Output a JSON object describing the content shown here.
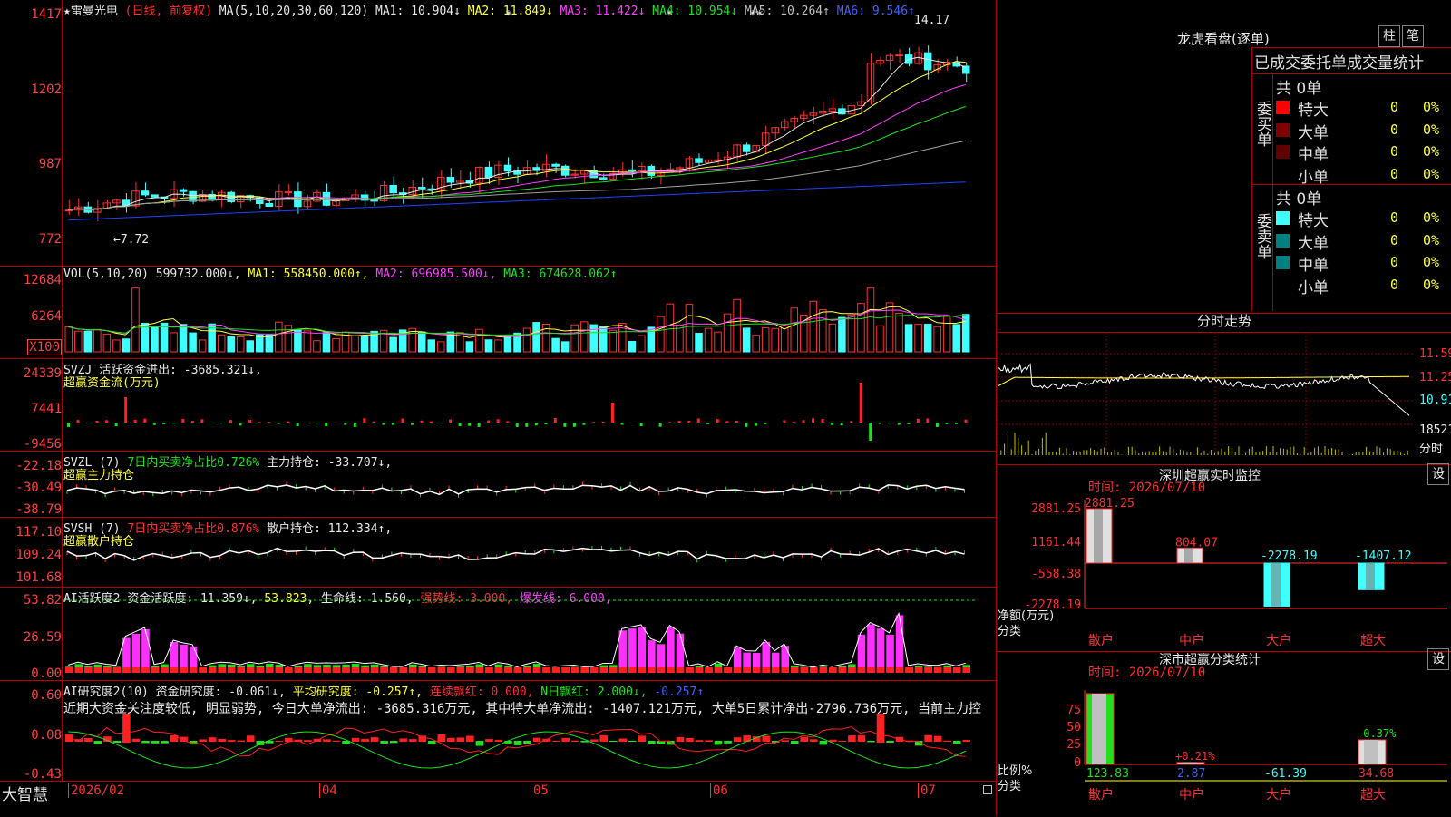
{
  "stock": {
    "title": "★雷曼光电",
    "mode": "(日线, 前复权)",
    "ma_header": "MA(5,10,20,30,60,120)",
    "ma": [
      {
        "label": "MA1: 10.904↓",
        "color": "#e8e8e8"
      },
      {
        "label": "MA2: 11.849↓",
        "color": "#ffff40"
      },
      {
        "label": "MA3: 11.422↓",
        "color": "#ff40ff"
      },
      {
        "label": "MA4: 10.954↓",
        "color": "#20e020"
      },
      {
        "label": "MA5: 10.264↑",
        "color": "#c0c0c0"
      },
      {
        "label": "MA6: 9.546↑",
        "color": "#4060ff"
      }
    ],
    "price_axis": [
      "1417",
      "1202",
      "987",
      "772"
    ],
    "high_marker": "14.17",
    "low_marker": "←7.72",
    "star_marks": [
      "*",
      "*",
      "**"
    ]
  },
  "volume": {
    "header": "VOL(5,10,20)",
    "value": "599732.000↓,",
    "ma1": "MA1: 558450.000↑,",
    "ma2": "MA2: 696985.500↓,",
    "ma3": "MA3: 674628.062↑",
    "axis": [
      "12684",
      "6264"
    ],
    "unit": "X100"
  },
  "svzj": {
    "header": "SVZJ  活跃资金进出: -3685.321↓,",
    "sub": "超赢资金流(万元)",
    "axis": [
      "24339",
      "7441",
      "-9456"
    ]
  },
  "svzl": {
    "header": "SVZL (7)",
    "ratio": "7日内买卖净占比0.726%",
    "pos": "主力持仓: -33.707↓,",
    "sub": "超赢主力持仓",
    "axis": [
      "-22.18",
      "-30.49",
      "-38.79"
    ]
  },
  "svsh": {
    "header": "SVSH (7)",
    "ratio": "7日内买卖净占比0.876%",
    "pos": "散户持仓: 112.334↑,",
    "sub": "超赢散户持仓",
    "axis": [
      "117.10",
      "109.24",
      "101.68"
    ]
  },
  "ai_active": {
    "header": "AI活跃度2",
    "v1": "资金活跃度: 11.359↓,",
    "v2": "53.823,",
    "v3": "生命线: 1.560,",
    "v4": "强势线: 3.000,",
    "v5": "爆发线: 6.000,",
    "axis": [
      "53.82",
      "26.59",
      "0.00"
    ]
  },
  "ai_research": {
    "header": "AI研究度2(10)",
    "v1": "资金研究度: -0.061↓,",
    "v2": "平均研究度: -0.257↑,",
    "v3": "连续飘红: 0.000,",
    "v4": "N日飘红: 2.000↓,",
    "v5": "-0.257↑",
    "comment": "近期大资金关注度较低, 明显弱势, 今日大单净流出: -3685.316万元, 其中特大单净流出: -1407.121万元, 大单5日累计净出-2796.736万元, 当前主力控",
    "axis": [
      "0.60",
      "0.08",
      "-0.43"
    ]
  },
  "bottom_axis": {
    "brand": "大智慧",
    "dates": [
      "2026/02",
      "04",
      "05",
      "06",
      "07"
    ]
  },
  "longhu": {
    "title": "龙虎看盘(逐单)",
    "btn1": "柱",
    "btn2": "笔",
    "subtitle": "已成交委托单成交量统计",
    "buy_label": "委买单",
    "sell_label": "委卖单",
    "buy_total": "共 0单",
    "sell_total": "共 0单",
    "buy_rows": [
      {
        "name": "特大",
        "count": "0",
        "pct": "0%",
        "color": "#ff0000"
      },
      {
        "name": "大单",
        "count": "0",
        "pct": "0%",
        "color": "#800000"
      },
      {
        "name": "中单",
        "count": "0",
        "pct": "0%",
        "color": "#600000"
      },
      {
        "name": "小单",
        "count": "0",
        "pct": "0%",
        "color": ""
      }
    ],
    "sell_rows": [
      {
        "name": "特大",
        "count": "0",
        "pct": "0%",
        "color": "#40ffff"
      },
      {
        "name": "大单",
        "count": "0",
        "pct": "0%",
        "color": "#008080"
      },
      {
        "name": "中单",
        "count": "0",
        "pct": "0%",
        "color": "#008080"
      },
      {
        "name": "小单",
        "count": "0",
        "pct": "0%",
        "color": ""
      }
    ]
  },
  "intraday": {
    "title": "分时走势",
    "axis": [
      "11.59",
      "11.25",
      "10.91",
      "18521"
    ],
    "unit": "分时"
  },
  "monitor": {
    "title": "深圳超赢实时监控",
    "btn": "设",
    "time": "时间: 2026/07/10",
    "axis": [
      "2881.25",
      "1161.44",
      "-558.38",
      "-2278.19"
    ],
    "ylabel": "净额(万元)",
    "xlabel": "分类",
    "bars": [
      {
        "cat": "散户",
        "label": "2881.25",
        "value": 2881.25
      },
      {
        "cat": "中户",
        "label": "804.07",
        "value": 804.07
      },
      {
        "cat": "大户",
        "label": "-2278.19",
        "value": -2278.19
      },
      {
        "cat": "超大",
        "label": "-1407.12",
        "value": -1407.12
      }
    ]
  },
  "classify": {
    "title": "深市超赢分类统计",
    "btn": "设",
    "time": "时间: 2026/07/10",
    "axis": [
      "75",
      "50",
      "25",
      "0"
    ],
    "ylabel": "比例%",
    "xlabel": "分类",
    "bars": [
      {
        "cat": "散户",
        "label": "123.83",
        "pct_label": "",
        "value": 100
      },
      {
        "cat": "中户",
        "label": "2.87",
        "pct_label": "+0.21%",
        "value": 2.87
      },
      {
        "cat": "大户",
        "label": "-61.39",
        "pct_label": "",
        "value": 0
      },
      {
        "cat": "超大",
        "label": "34.68",
        "pct_label": "-0.37%",
        "value": 34.68
      }
    ]
  }
}
